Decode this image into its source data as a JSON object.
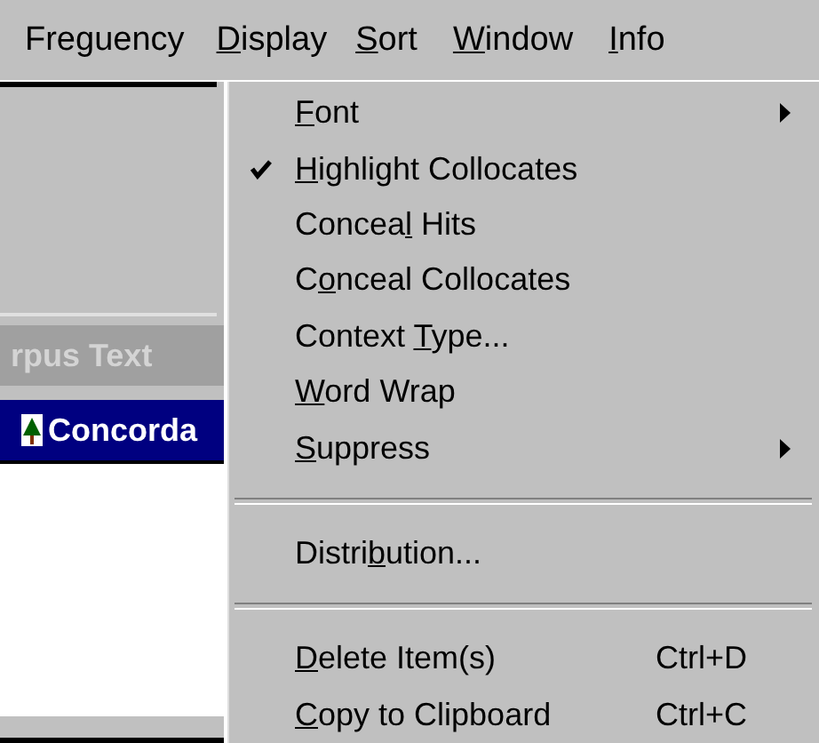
{
  "menu_bar": [
    {
      "label": {
        "before": "Freguency"
      },
      "selected": false
    },
    {
      "label": {
        "key": "D",
        "after": "isplay"
      },
      "selected": true
    },
    {
      "label": {
        "key": "S",
        "after": "ort"
      },
      "selected": false
    },
    {
      "label": {
        "key": "W",
        "after": "indow"
      },
      "selected": false
    },
    {
      "label": {
        "key": "I",
        "after": "nfo"
      },
      "selected": false
    }
  ],
  "background_windows": {
    "inactive_title": "rpus Text",
    "active_title": "Concorda"
  },
  "dropdown_menu": [
    {
      "kind": "item",
      "label": {
        "key": "F",
        "after": "ont"
      },
      "checked": false,
      "submenu": true
    },
    {
      "kind": "item",
      "label": {
        "key": "H",
        "after": "ighlight Collocates"
      },
      "checked": true,
      "submenu": false
    },
    {
      "kind": "item",
      "label": {
        "before": "Concea",
        "key": "l",
        "after": " Hits"
      },
      "checked": false,
      "submenu": false
    },
    {
      "kind": "item",
      "label": {
        "before": "C",
        "key": "o",
        "after": "nceal Collocates"
      },
      "checked": false,
      "submenu": false
    },
    {
      "kind": "item",
      "label": {
        "before": "Context ",
        "key": "T",
        "after": "ype..."
      },
      "checked": false,
      "submenu": false
    },
    {
      "kind": "item",
      "label": {
        "key": "W",
        "after": "ord Wrap"
      },
      "checked": false,
      "submenu": false
    },
    {
      "kind": "item",
      "label": {
        "key": "S",
        "after": "uppress"
      },
      "checked": false,
      "submenu": true
    },
    {
      "kind": "separator"
    },
    {
      "kind": "item",
      "label": {
        "before": "Distri",
        "key": "b",
        "after": "ution..."
      },
      "checked": false,
      "submenu": false
    },
    {
      "kind": "separator"
    },
    {
      "kind": "item",
      "label": {
        "key": "D",
        "after": "elete Item(s)"
      },
      "checked": false,
      "submenu": false,
      "shortcut": "Ctrl+D"
    },
    {
      "kind": "item",
      "label": {
        "key": "C",
        "after": "opy to Clipboard"
      },
      "checked": false,
      "submenu": false,
      "shortcut": "Ctrl+C"
    }
  ]
}
